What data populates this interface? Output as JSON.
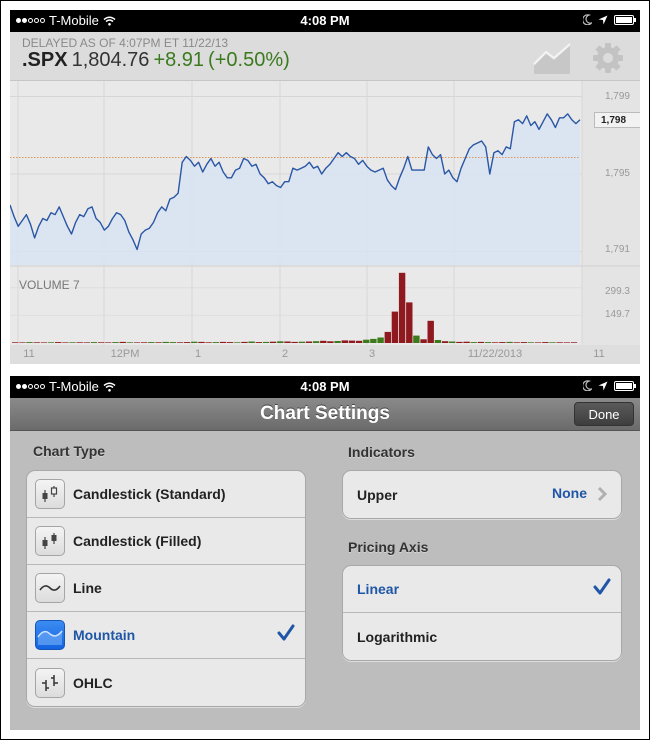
{
  "status_bar": {
    "carrier": "T-Mobile",
    "signal_bars_filled": 2,
    "signal_bars_total": 5,
    "time": "4:08 PM",
    "icons": [
      "wifi-icon",
      "moon-icon",
      "location-arrow-icon",
      "battery-icon"
    ]
  },
  "quote": {
    "delayed_text": "DELAYED AS OF 4:07PM ET 11/22/13",
    "symbol": ".SPX",
    "last": "1,804.76",
    "change": "+8.91",
    "change_pct": "(+0.50%)",
    "change_color": "#3b7a1e"
  },
  "header_icons": {
    "chart_type": "mountain-chart-icon",
    "settings": "gear-icon"
  },
  "chart_data": [
    {
      "type": "area",
      "title": "",
      "series": [
        {
          "name": ".SPX price",
          "color": "#2a56a6",
          "fill": "#d8e4f2",
          "values": [
            1793.4,
            1792.8,
            1792.3,
            1792.6,
            1792.9,
            1792.4,
            1791.7,
            1792.3,
            1792.7,
            1792.6,
            1793.0,
            1792.9,
            1793.3,
            1792.8,
            1792.3,
            1791.9,
            1792.5,
            1792.9,
            1792.8,
            1793.2,
            1793.3,
            1792.7,
            1792.5,
            1792.1,
            1792.3,
            1792.7,
            1793.0,
            1792.9,
            1792.6,
            1792.0,
            1791.6,
            1791.1,
            1791.9,
            1792.1,
            1792.2,
            1792.5,
            1793.0,
            1793.3,
            1793.1,
            1793.7,
            1793.8,
            1794.0,
            1795.6,
            1795.9,
            1795.7,
            1795.4,
            1795.6,
            1795.1,
            1795.5,
            1795.8,
            1795.4,
            1795.6,
            1795.1,
            1794.8,
            1794.8,
            1795.2,
            1795.3,
            1795.8,
            1795.7,
            1795.4,
            1795.5,
            1795.0,
            1794.8,
            1794.5,
            1794.6,
            1794.4,
            1794.3,
            1794.6,
            1794.6,
            1795.3,
            1795.2,
            1795.3,
            1795.4,
            1795.6,
            1795.3,
            1795.4,
            1795.0,
            1795.3,
            1795.5,
            1795.8,
            1796.1,
            1795.9,
            1796.1,
            1795.9,
            1795.8,
            1795.5,
            1795.7,
            1795.4,
            1795.2,
            1795.1,
            1795.2,
            1795.3,
            1794.7,
            1794.4,
            1794.2,
            1794.8,
            1795.3,
            1795.9,
            1795.2,
            1795.2,
            1795.2,
            1795.2,
            1796.4,
            1796.0,
            1795.8,
            1796.0,
            1795.0,
            1795.2,
            1794.8,
            1794.6,
            1795.3,
            1795.8,
            1796.3,
            1796.5,
            1796.6,
            1796.7,
            1796.4,
            1795.0,
            1796.1,
            1796.2,
            1796.0,
            1796.4,
            1796.3,
            1797.7,
            1797.8,
            1797.6,
            1798.0,
            1797.5,
            1797.7,
            1797.3,
            1797.7,
            1798.1,
            1797.8,
            1797.4,
            1797.9,
            1797.9,
            1798.1,
            1797.8,
            1797.6,
            1797.8
          ]
        }
      ],
      "y_ticks": [
        "1,799",
        "1,795",
        "1,791"
      ],
      "y_tick_values": [
        1799,
        1795,
        1791
      ],
      "ylim": [
        1790.3,
        1799.8
      ],
      "current_value_label": "1,798",
      "previous_close_line": 1795.85,
      "grid": true
    },
    {
      "type": "bar",
      "title": "VOLUME 7",
      "y_ticks": [
        "299.3",
        "149.7"
      ],
      "y_tick_values": [
        299.3,
        149.7
      ],
      "ylim": [
        0,
        390
      ],
      "colors": {
        "down": "#8e1a1f",
        "up": "#3d7a1c"
      },
      "series": [
        {
          "name": "volume",
          "values": [
            4,
            3,
            5,
            4,
            3,
            4,
            5,
            3,
            4,
            4,
            3,
            5,
            4,
            3,
            5,
            6,
            4,
            3,
            4,
            5,
            4,
            6,
            5,
            4,
            5,
            7,
            6,
            4,
            5,
            6,
            5,
            4,
            6,
            8,
            5,
            6,
            7,
            9,
            8,
            6,
            7,
            8,
            10,
            12,
            9,
            11,
            14,
            13,
            12,
            18,
            22,
            30,
            60,
            170,
            380,
            220,
            40,
            20,
            120,
            16,
            10,
            8,
            6,
            7,
            5,
            6,
            5,
            4,
            5,
            6,
            4,
            5,
            4,
            3,
            5,
            4,
            4,
            3,
            4
          ],
          "direction": [
            "d",
            "d",
            "u",
            "d",
            "d",
            "u",
            "d",
            "d",
            "u",
            "d",
            "d",
            "u",
            "d",
            "d",
            "u",
            "d",
            "u",
            "d",
            "d",
            "u",
            "d",
            "u",
            "u",
            "d",
            "d",
            "u",
            "d",
            "d",
            "u",
            "d",
            "d",
            "u",
            "d",
            "u",
            "d",
            "u",
            "d",
            "u",
            "d",
            "d",
            "u",
            "d",
            "u",
            "d",
            "d",
            "u",
            "d",
            "d",
            "d",
            "u",
            "u",
            "u",
            "d",
            "d",
            "d",
            "d",
            "u",
            "d",
            "d",
            "u",
            "d",
            "u",
            "d",
            "d",
            "u",
            "d",
            "u",
            "d",
            "d",
            "u",
            "d",
            "d",
            "u",
            "d",
            "d",
            "u",
            "d",
            "d",
            "d"
          ]
        }
      ]
    }
  ],
  "x_axis_labels": [
    "11",
    "12PM",
    "1",
    "2",
    "3",
    "11/22/2013",
    "11"
  ],
  "settings": {
    "title": "Chart Settings",
    "done_label": "Done",
    "chart_type": {
      "header": "Chart Type",
      "options": [
        {
          "label": "Candlestick (Standard)",
          "icon": "candlestick-standard-icon",
          "selected": false
        },
        {
          "label": "Candlestick (Filled)",
          "icon": "candlestick-filled-icon",
          "selected": false
        },
        {
          "label": "Line",
          "icon": "line-chart-icon",
          "selected": false
        },
        {
          "label": "Mountain",
          "icon": "mountain-chart-icon",
          "selected": true
        },
        {
          "label": "OHLC",
          "icon": "ohlc-chart-icon",
          "selected": false
        }
      ]
    },
    "indicators": {
      "header": "Indicators",
      "upper_label": "Upper",
      "upper_value": "None"
    },
    "pricing_axis": {
      "header": "Pricing Axis",
      "options": [
        {
          "label": "Linear",
          "selected": true
        },
        {
          "label": "Logarithmic",
          "selected": false
        }
      ]
    },
    "accent_color": "#1f56a6"
  }
}
